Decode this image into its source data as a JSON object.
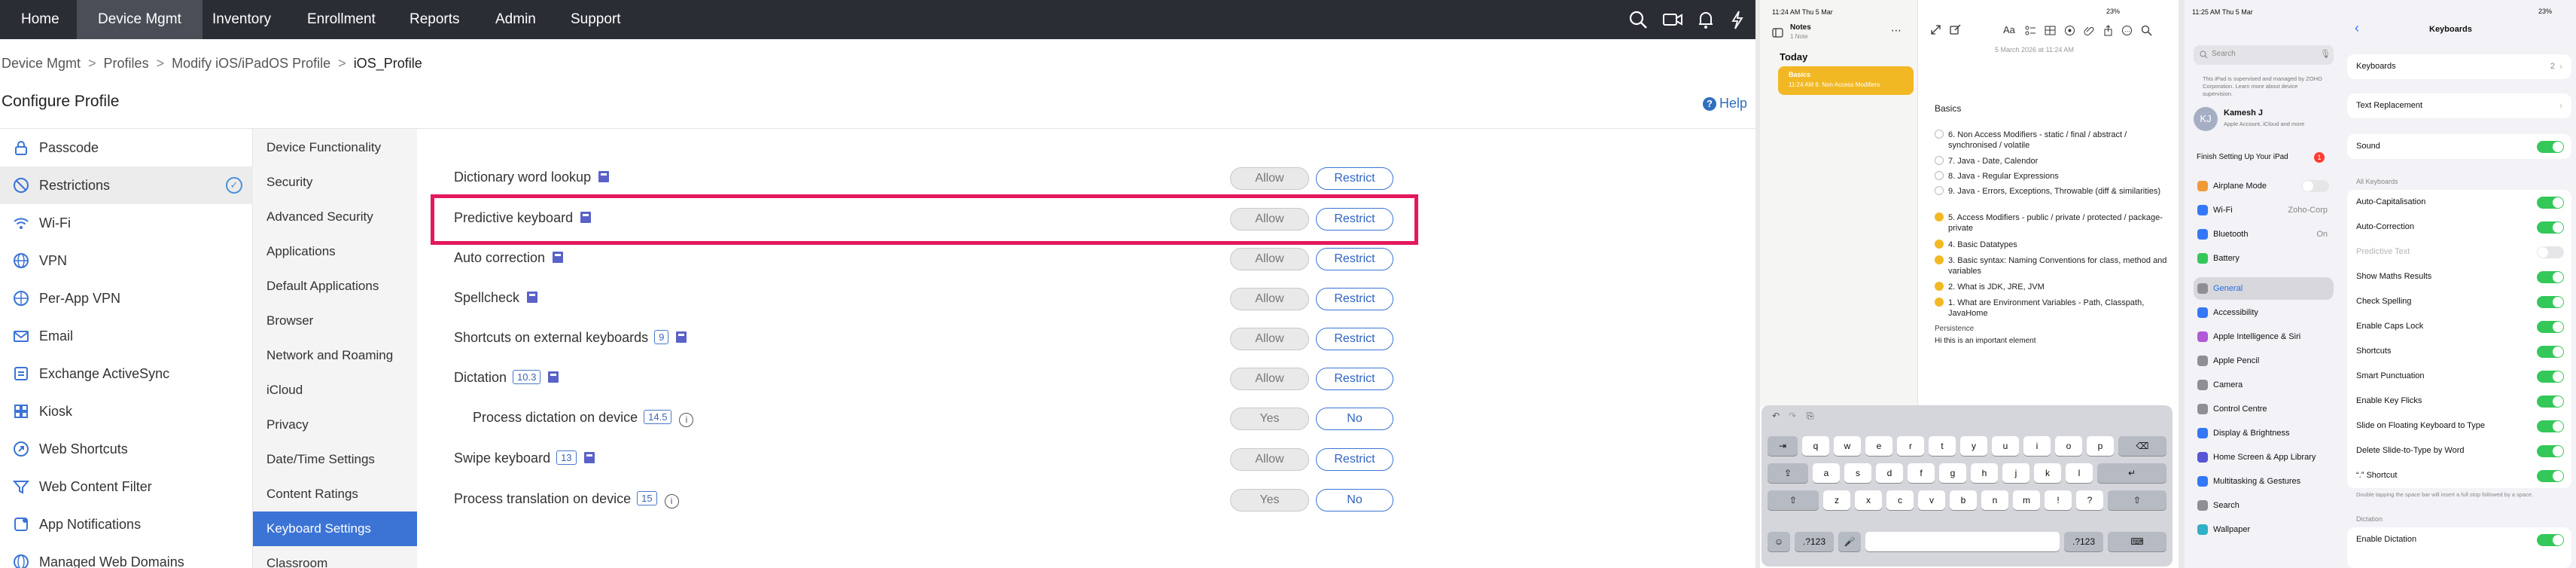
{
  "nav": {
    "items": [
      "Home",
      "Device Mgmt",
      "Inventory",
      "Enrollment",
      "Reports",
      "Admin",
      "Support"
    ],
    "active": "Device Mgmt"
  },
  "breadcrumb": [
    "Device Mgmt",
    "Profiles",
    "Modify iOS/iPadOS Profile",
    "iOS_Profile"
  ],
  "page_title": "Configure Profile",
  "help_label": "Help",
  "left_menu": [
    "Passcode",
    "Restrictions",
    "Wi-Fi",
    "VPN",
    "Per-App VPN",
    "Email",
    "Exchange ActiveSync",
    "Kiosk",
    "Web Shortcuts",
    "Web Content Filter",
    "App Notifications",
    "Managed Web Domains"
  ],
  "sub_menu": [
    "Device Functionality",
    "Security",
    "Advanced Security",
    "Applications",
    "Default Applications",
    "Browser",
    "Network and Roaming",
    "iCloud",
    "Privacy",
    "Date/Time Settings",
    "Content Ratings",
    "Keyboard Settings",
    "Classroom"
  ],
  "settings": [
    {
      "label": "Dictionary word lookup",
      "version": "",
      "off": "Allow",
      "on": "Restrict"
    },
    {
      "label": "Predictive keyboard",
      "version": "",
      "off": "Allow",
      "on": "Restrict"
    },
    {
      "label": "Auto correction",
      "version": "",
      "off": "Allow",
      "on": "Restrict"
    },
    {
      "label": "Spellcheck",
      "version": "",
      "off": "Allow",
      "on": "Restrict"
    },
    {
      "label": "Shortcuts on external keyboards",
      "version": "9",
      "off": "Allow",
      "on": "Restrict"
    },
    {
      "label": "Dictation",
      "version": "10.3",
      "off": "Allow",
      "on": "Restrict"
    },
    {
      "label": "Process dictation on device",
      "version": "14.5",
      "off": "Yes",
      "on": "No"
    },
    {
      "label": "Swipe keyboard",
      "version": "13",
      "off": "Allow",
      "on": "Restrict"
    },
    {
      "label": "Process translation on device",
      "version": "15",
      "off": "Yes",
      "on": "No"
    }
  ],
  "notes": {
    "status_time": "11:24 AM  Thu 5 Mar",
    "status_right": "23%",
    "folder_title": "Notes",
    "folder_count": "1 Note",
    "section": "Today",
    "card_title": "Basics",
    "card_preview": "11:24 AM  6. Non Access Modifiers",
    "date_line": "5 March 2026 at 11:24 AM",
    "heading": "Basics",
    "items": [
      {
        "text": "6. Non Access Modifiers - static / final / abstract / synchronised / volatile",
        "done": false
      },
      {
        "text": "7. Java - Date, Calendor",
        "done": false
      },
      {
        "text": "8. Java - Regular Expressions",
        "done": false
      },
      {
        "text": "9. Java - Errors, Exceptions, Throwable (diff & similarities)",
        "done": false
      },
      {
        "text": "5. Access Modifiers - public / private / protected / package-private",
        "done": true
      },
      {
        "text": "4. Basic Datatypes",
        "done": true
      },
      {
        "text": "3. Basic syntax: Naming Conventions for class, method and variables",
        "done": true
      },
      {
        "text": "2. What is JDK, JRE, JVM",
        "done": true
      },
      {
        "text": "1. What are Environment Variables - Path, Classpath, JavaHome",
        "done": true
      }
    ],
    "footer1": "Persistence",
    "footer2": "Hi this is an important element",
    "kb_rows": [
      [
        "q",
        "w",
        "e",
        "r",
        "t",
        "y",
        "u",
        "i",
        "o",
        "p"
      ],
      [
        "a",
        "s",
        "d",
        "f",
        "g",
        "h",
        "j",
        "k",
        "l"
      ],
      [
        "z",
        "x",
        "c",
        "v",
        "b",
        "n",
        "m",
        "!",
        "?"
      ]
    ],
    "kb_num": ".?123"
  },
  "ios_settings": {
    "status_time": "11:25 AM  Thu 5 Mar",
    "status_right": "23%",
    "search_placeholder": "Search",
    "supervised_text": "This iPad is supervised and managed by ZOHO Corporation. Learn more about device supervision.",
    "account_initials": "KJ",
    "account_name": "Kamesh J",
    "account_sub": "Apple Account, iCloud and more",
    "finish_setup": "Finish Setting Up Your iPad",
    "finish_badge": "1",
    "side_items": [
      {
        "label": "Airplane Mode",
        "value": "",
        "color": "#f09a37"
      },
      {
        "label": "Wi-Fi",
        "value": "Zoho-Corp",
        "color": "#3478f6"
      },
      {
        "label": "Bluetooth",
        "value": "On",
        "color": "#3478f6"
      },
      {
        "label": "Battery",
        "value": "",
        "color": "#34c759"
      },
      {
        "label": "General",
        "value": "",
        "color": "#8e8e93"
      },
      {
        "label": "Accessibility",
        "value": "",
        "color": "#3478f6"
      },
      {
        "label": "Apple Intelligence & Siri",
        "value": "",
        "color": "#b05ad8"
      },
      {
        "label": "Apple Pencil",
        "value": "",
        "color": "#8e8e93"
      },
      {
        "label": "Camera",
        "value": "",
        "color": "#8e8e93"
      },
      {
        "label": "Control Centre",
        "value": "",
        "color": "#8e8e93"
      },
      {
        "label": "Display & Brightness",
        "value": "",
        "color": "#3478f6"
      },
      {
        "label": "Home Screen & App Library",
        "value": "",
        "color": "#5856d6"
      },
      {
        "label": "Multitasking & Gestures",
        "value": "",
        "color": "#3478f6"
      },
      {
        "label": "Search",
        "value": "",
        "color": "#8e8e93"
      },
      {
        "label": "Wallpaper",
        "value": "",
        "color": "#30b0c7"
      }
    ],
    "page_title": "Keyboards",
    "keyboards_label": "Keyboards",
    "keyboards_count": "2",
    "text_replacement": "Text Replacement",
    "sound": "Sound",
    "all_keyboards": "All Keyboards",
    "toggles": [
      {
        "label": "Auto-Capitalisation",
        "on": true,
        "dim": false
      },
      {
        "label": "Auto-Correction",
        "on": true,
        "dim": false
      },
      {
        "label": "Predictive Text",
        "on": false,
        "dim": true
      },
      {
        "label": "Show Maths Results",
        "on": true,
        "dim": false
      },
      {
        "label": "Check Spelling",
        "on": true,
        "dim": false
      },
      {
        "label": "Enable Caps Lock",
        "on": true,
        "dim": false
      },
      {
        "label": "Shortcuts",
        "on": true,
        "dim": false
      },
      {
        "label": "Smart Punctuation",
        "on": true,
        "dim": false
      },
      {
        "label": "Enable Key Flicks",
        "on": true,
        "dim": false
      },
      {
        "label": "Slide on Floating Keyboard to Type",
        "on": true,
        "dim": false
      },
      {
        "label": "Delete Slide-to-Type by Word",
        "on": true,
        "dim": false
      },
      {
        "label": "“.” Shortcut",
        "on": true,
        "dim": false
      }
    ],
    "shortcut_note": "Double tapping the space bar will insert a full stop followed by a space.",
    "dictation_header": "Dictation",
    "enable_dictation": "Enable Dictation"
  },
  "colors": {
    "accent": "#3b74d5",
    "highlight": "#e4185e",
    "navbar": "#2a2e34",
    "ios_green": "#34c759"
  }
}
